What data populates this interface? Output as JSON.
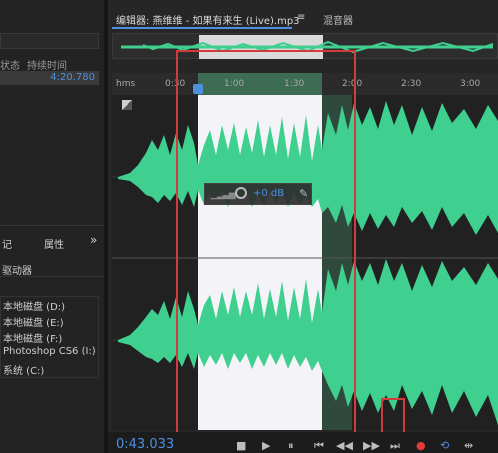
{
  "left_panel": {
    "col_status": "状态",
    "col_duration": "持续时间",
    "file_duration": "4:20.780",
    "tabs": [
      "记",
      "属性"
    ],
    "more_icon": "»",
    "section_title": "驱动器",
    "drives": [
      "本地磁盘 (D:)",
      "本地磁盘 (E:)",
      "本地磁盘 (F:)",
      "Photoshop CS6 (I:)",
      "系统 (C:)"
    ]
  },
  "editor": {
    "tab_editor": "编辑器: 燕维维 - 如果有来生 (Live).mp3",
    "tab_menu": "≡",
    "tab_mixer": "混音器",
    "ruler": {
      "unit": "hms",
      "labels": [
        "0:30",
        "1:00",
        "1:30",
        "2:00",
        "2:30",
        "3:00"
      ]
    },
    "gain_hud": {
      "value": "+0 dB"
    }
  },
  "transport": {
    "time": "0:43.033",
    "buttons": [
      "■",
      "▶",
      "⏸",
      "⏮",
      "◀◀",
      "▶▶",
      "⏭",
      "●",
      "⟲",
      "⇹"
    ]
  },
  "colors": {
    "waveform": "#3fcf8f",
    "selection": "#f4f4f8",
    "playhead": "#4f8fe0",
    "annotation": "#d03c3c",
    "time_text": "#4f8fe0"
  },
  "icons": [
    "zoom-region-icon",
    "bar-meter-icon",
    "knob-icon",
    "pin-icon",
    "playhead-marker-icon"
  ]
}
